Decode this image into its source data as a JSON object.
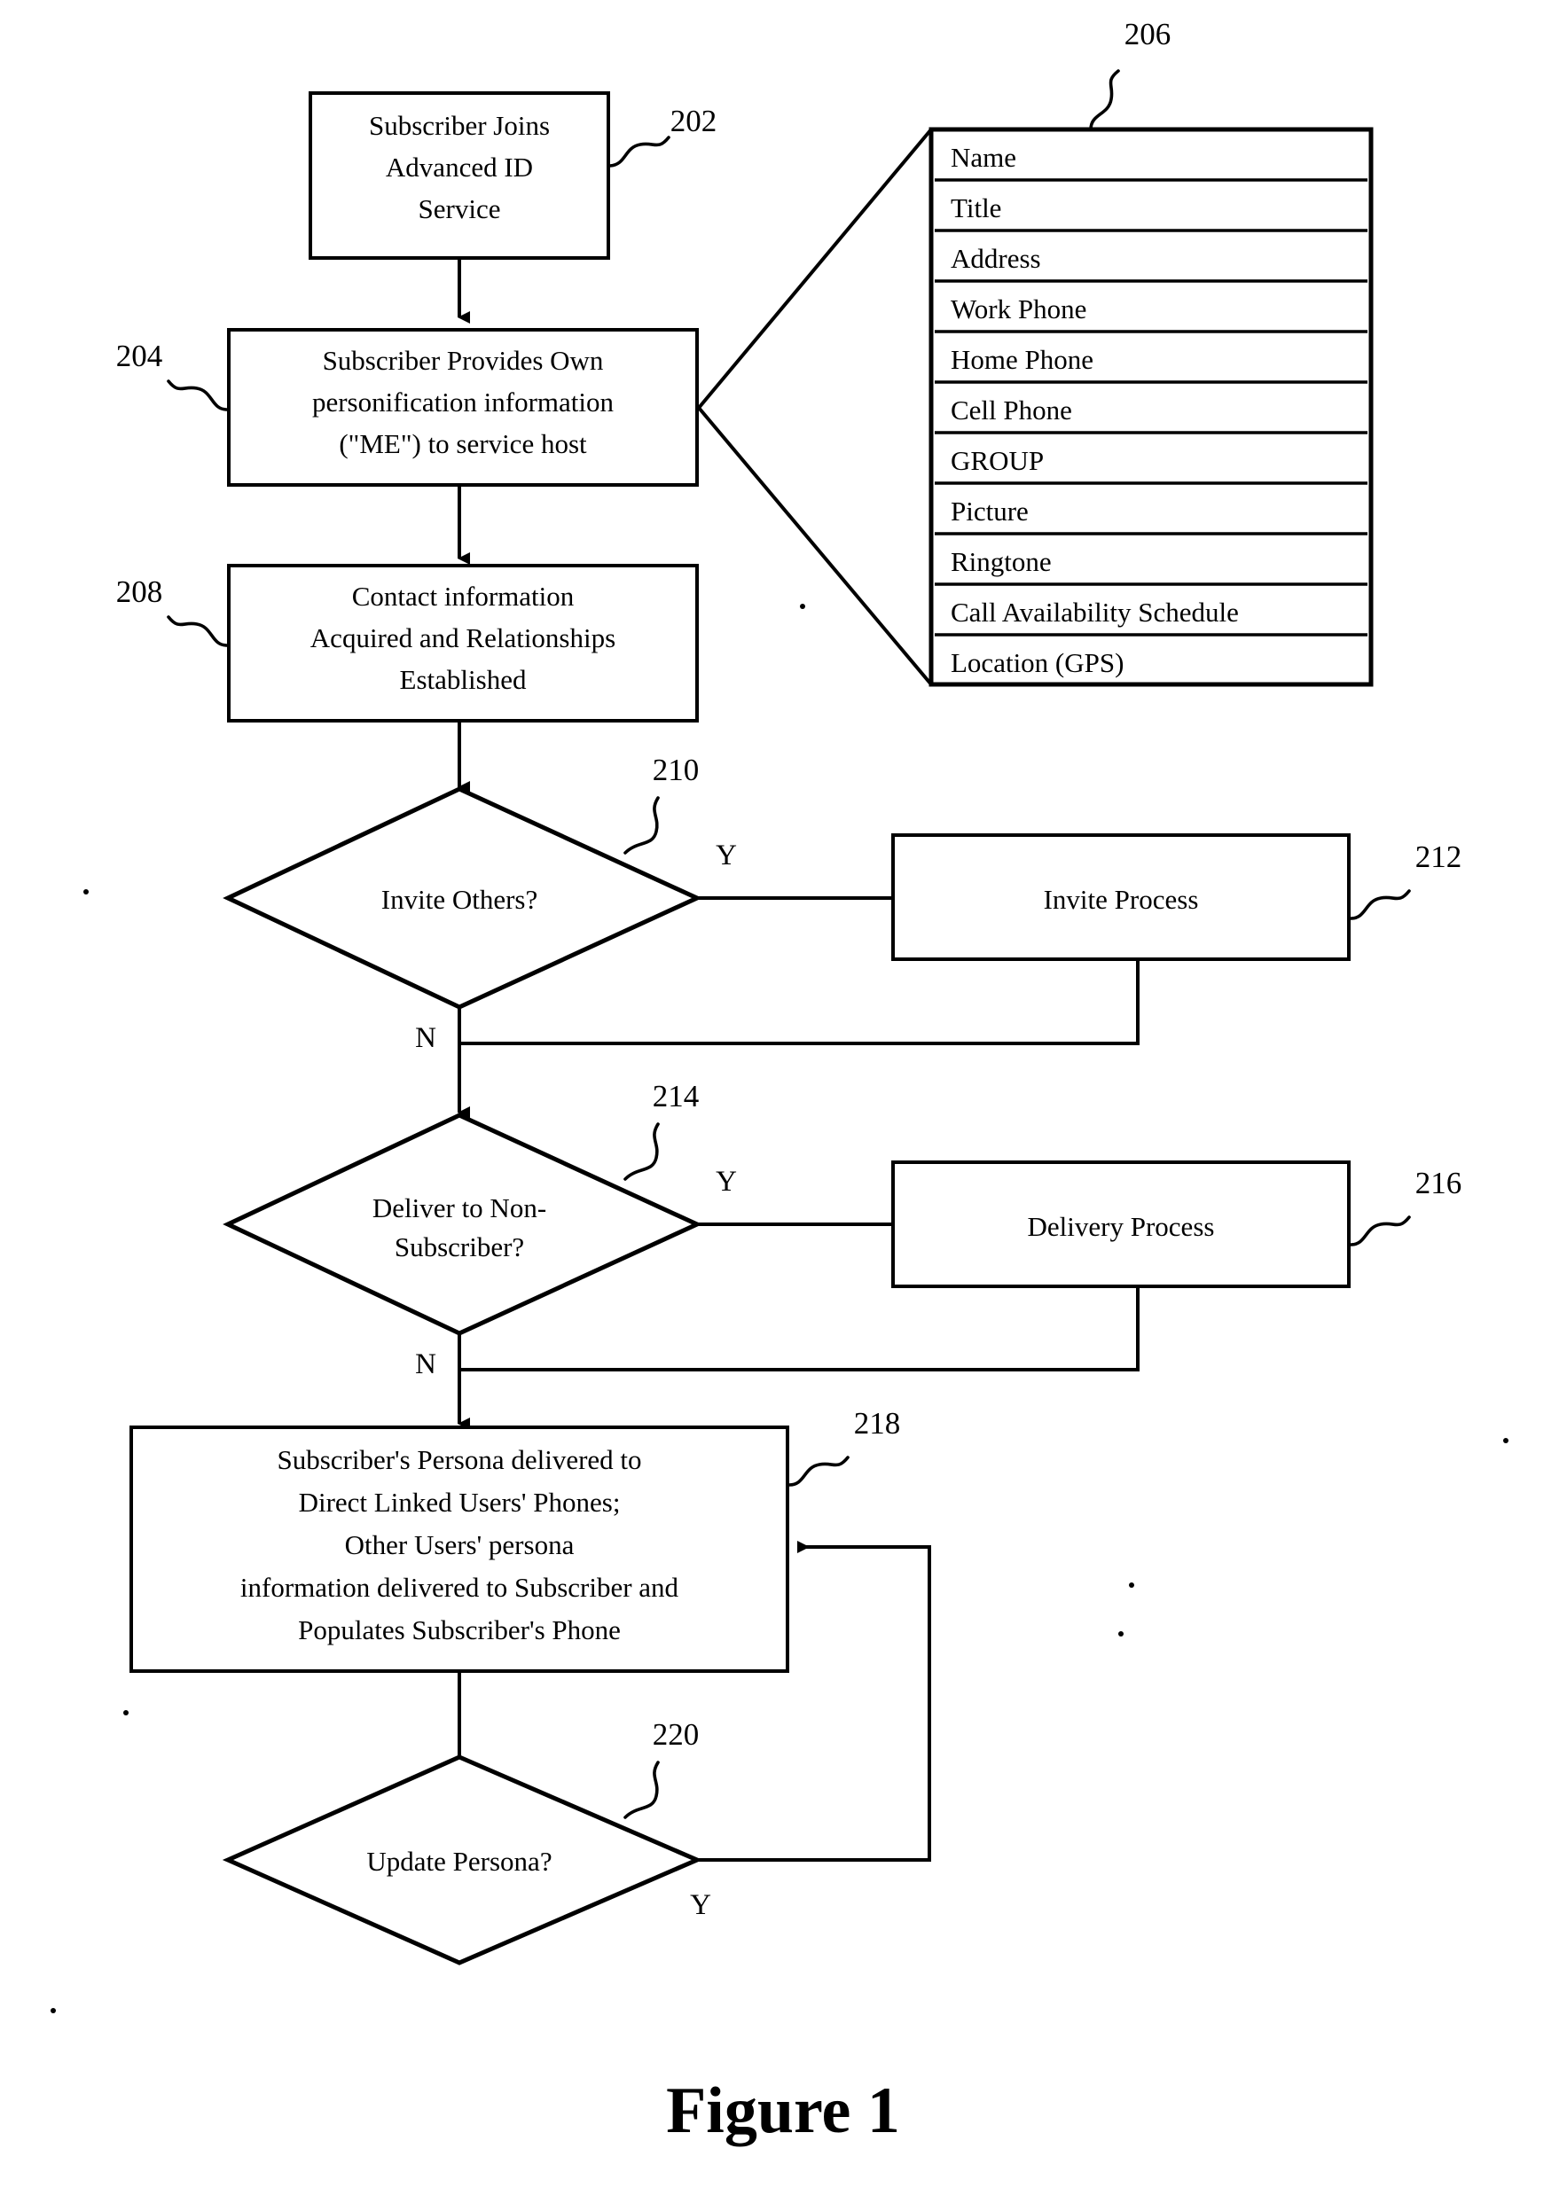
{
  "figure": {
    "caption": "Figure 1"
  },
  "nodes": {
    "n202": {
      "ref": "202",
      "lines": [
        "Subscriber Joins",
        "Advanced ID",
        "Service"
      ]
    },
    "n204": {
      "ref": "204",
      "lines": [
        "Subscriber Provides Own",
        "personification information",
        "(\"ME\") to service host"
      ]
    },
    "n208": {
      "ref": "208",
      "lines": [
        "Contact information",
        "Acquired and Relationships",
        "Established"
      ]
    },
    "n210": {
      "ref": "210",
      "lines": [
        "Invite Others?"
      ],
      "yes_label": "Y",
      "no_label": "N"
    },
    "n212": {
      "ref": "212",
      "lines": [
        "Invite Process"
      ]
    },
    "n214": {
      "ref": "214",
      "lines": [
        "Deliver to Non-",
        "Subscriber?"
      ],
      "yes_label": "Y",
      "no_label": "N"
    },
    "n216": {
      "ref": "216",
      "lines": [
        "Delivery Process"
      ]
    },
    "n218": {
      "ref": "218",
      "lines": [
        "Subscriber's Persona delivered to",
        "Direct Linked Users' Phones;",
        "Other Users' persona",
        "information delivered to Subscriber and",
        "Populates Subscriber's Phone"
      ]
    },
    "n220": {
      "ref": "220",
      "lines": [
        "Update Persona?"
      ],
      "yes_label": "Y"
    }
  },
  "persona_table": {
    "ref": "206",
    "rows": [
      "Name",
      "Title",
      "Address",
      "Work Phone",
      "Home Phone",
      "Cell Phone",
      "GROUP",
      "Picture",
      "Ringtone",
      "Call Availability Schedule",
      "Location (GPS)"
    ]
  },
  "colors": {
    "ink": "#000000",
    "paper": "#ffffff"
  }
}
